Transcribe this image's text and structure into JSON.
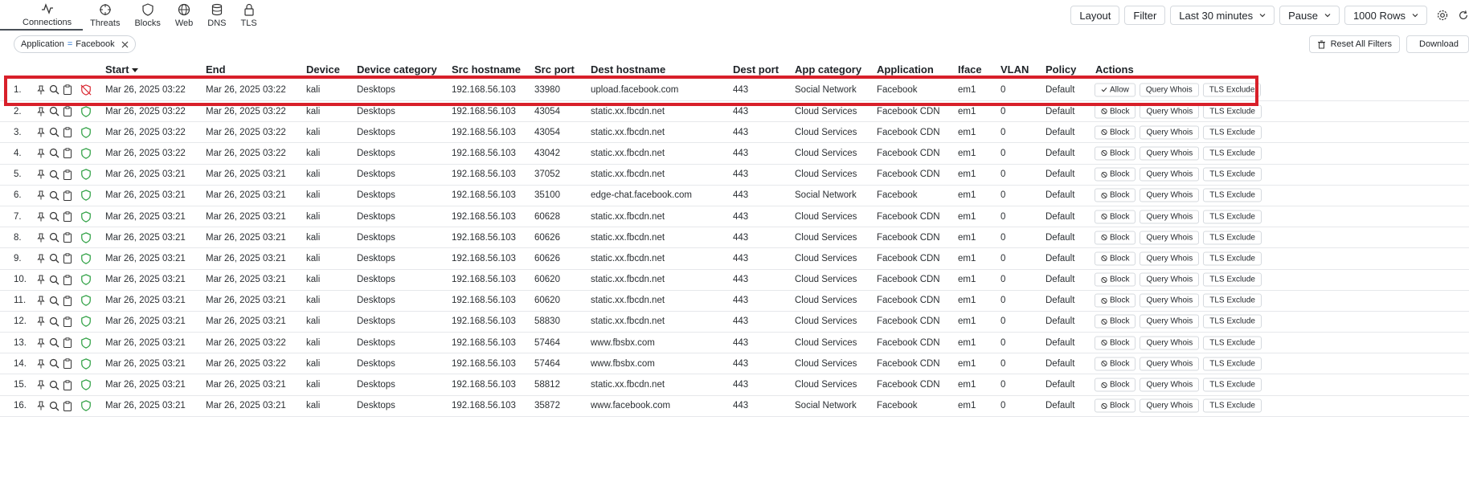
{
  "nav": {
    "tabs": [
      {
        "label": "Connections",
        "icon": "activity-icon",
        "active": true
      },
      {
        "label": "Threats",
        "icon": "crosshair-icon"
      },
      {
        "label": "Blocks",
        "icon": "shield-icon"
      },
      {
        "label": "Web",
        "icon": "globe-icon"
      },
      {
        "label": "DNS",
        "icon": "database-icon"
      },
      {
        "label": "TLS",
        "icon": "lock-icon"
      }
    ]
  },
  "toolbar": {
    "layout": "Layout",
    "filter": "Filter",
    "timerange": "Last 30 minutes",
    "pause": "Pause",
    "rows": "1000 Rows"
  },
  "filters": {
    "chip_key": "Application",
    "chip_op": "=",
    "chip_value": "Facebook",
    "reset": "Reset All Filters",
    "download": "Download"
  },
  "table": {
    "headers": {
      "start": "Start",
      "end": "End",
      "device": "Device",
      "device_category": "Device category",
      "src_hostname": "Src hostname",
      "src_port": "Src port",
      "dest_hostname": "Dest hostname",
      "dest_port": "Dest port",
      "app_category": "App category",
      "application": "Application",
      "iface": "Iface",
      "vlan": "VLAN",
      "policy": "Policy",
      "actions": "Actions"
    },
    "actions": {
      "allow": "Allow",
      "block": "Block",
      "whois": "Query Whois",
      "tls": "TLS Exclude"
    },
    "rows": [
      {
        "n": "1.",
        "start": "Mar 26, 2025 03:22",
        "end": "Mar 26, 2025 03:22",
        "device": "kali",
        "cat": "Desktops",
        "src": "192.168.56.103",
        "sport": "33980",
        "dest": "upload.facebook.com",
        "dport": "443",
        "appcat": "Social Network",
        "app": "Facebook",
        "iface": "em1",
        "vlan": "0",
        "policy": "Default",
        "blocked": true
      },
      {
        "n": "2.",
        "start": "Mar 26, 2025 03:22",
        "end": "Mar 26, 2025 03:22",
        "device": "kali",
        "cat": "Desktops",
        "src": "192.168.56.103",
        "sport": "43054",
        "dest": "static.xx.fbcdn.net",
        "dport": "443",
        "appcat": "Cloud Services",
        "app": "Facebook CDN",
        "iface": "em1",
        "vlan": "0",
        "policy": "Default",
        "blocked": false
      },
      {
        "n": "3.",
        "start": "Mar 26, 2025 03:22",
        "end": "Mar 26, 2025 03:22",
        "device": "kali",
        "cat": "Desktops",
        "src": "192.168.56.103",
        "sport": "43054",
        "dest": "static.xx.fbcdn.net",
        "dport": "443",
        "appcat": "Cloud Services",
        "app": "Facebook CDN",
        "iface": "em1",
        "vlan": "0",
        "policy": "Default",
        "blocked": false
      },
      {
        "n": "4.",
        "start": "Mar 26, 2025 03:22",
        "end": "Mar 26, 2025 03:22",
        "device": "kali",
        "cat": "Desktops",
        "src": "192.168.56.103",
        "sport": "43042",
        "dest": "static.xx.fbcdn.net",
        "dport": "443",
        "appcat": "Cloud Services",
        "app": "Facebook CDN",
        "iface": "em1",
        "vlan": "0",
        "policy": "Default",
        "blocked": false
      },
      {
        "n": "5.",
        "start": "Mar 26, 2025 03:21",
        "end": "Mar 26, 2025 03:21",
        "device": "kali",
        "cat": "Desktops",
        "src": "192.168.56.103",
        "sport": "37052",
        "dest": "static.xx.fbcdn.net",
        "dport": "443",
        "appcat": "Cloud Services",
        "app": "Facebook CDN",
        "iface": "em1",
        "vlan": "0",
        "policy": "Default",
        "blocked": false
      },
      {
        "n": "6.",
        "start": "Mar 26, 2025 03:21",
        "end": "Mar 26, 2025 03:21",
        "device": "kali",
        "cat": "Desktops",
        "src": "192.168.56.103",
        "sport": "35100",
        "dest": "edge-chat.facebook.com",
        "dport": "443",
        "appcat": "Social Network",
        "app": "Facebook",
        "iface": "em1",
        "vlan": "0",
        "policy": "Default",
        "blocked": false
      },
      {
        "n": "7.",
        "start": "Mar 26, 2025 03:21",
        "end": "Mar 26, 2025 03:21",
        "device": "kali",
        "cat": "Desktops",
        "src": "192.168.56.103",
        "sport": "60628",
        "dest": "static.xx.fbcdn.net",
        "dport": "443",
        "appcat": "Cloud Services",
        "app": "Facebook CDN",
        "iface": "em1",
        "vlan": "0",
        "policy": "Default",
        "blocked": false
      },
      {
        "n": "8.",
        "start": "Mar 26, 2025 03:21",
        "end": "Mar 26, 2025 03:21",
        "device": "kali",
        "cat": "Desktops",
        "src": "192.168.56.103",
        "sport": "60626",
        "dest": "static.xx.fbcdn.net",
        "dport": "443",
        "appcat": "Cloud Services",
        "app": "Facebook CDN",
        "iface": "em1",
        "vlan": "0",
        "policy": "Default",
        "blocked": false
      },
      {
        "n": "9.",
        "start": "Mar 26, 2025 03:21",
        "end": "Mar 26, 2025 03:21",
        "device": "kali",
        "cat": "Desktops",
        "src": "192.168.56.103",
        "sport": "60626",
        "dest": "static.xx.fbcdn.net",
        "dport": "443",
        "appcat": "Cloud Services",
        "app": "Facebook CDN",
        "iface": "em1",
        "vlan": "0",
        "policy": "Default",
        "blocked": false
      },
      {
        "n": "10.",
        "start": "Mar 26, 2025 03:21",
        "end": "Mar 26, 2025 03:21",
        "device": "kali",
        "cat": "Desktops",
        "src": "192.168.56.103",
        "sport": "60620",
        "dest": "static.xx.fbcdn.net",
        "dport": "443",
        "appcat": "Cloud Services",
        "app": "Facebook CDN",
        "iface": "em1",
        "vlan": "0",
        "policy": "Default",
        "blocked": false
      },
      {
        "n": "11.",
        "start": "Mar 26, 2025 03:21",
        "end": "Mar 26, 2025 03:21",
        "device": "kali",
        "cat": "Desktops",
        "src": "192.168.56.103",
        "sport": "60620",
        "dest": "static.xx.fbcdn.net",
        "dport": "443",
        "appcat": "Cloud Services",
        "app": "Facebook CDN",
        "iface": "em1",
        "vlan": "0",
        "policy": "Default",
        "blocked": false
      },
      {
        "n": "12.",
        "start": "Mar 26, 2025 03:21",
        "end": "Mar 26, 2025 03:21",
        "device": "kali",
        "cat": "Desktops",
        "src": "192.168.56.103",
        "sport": "58830",
        "dest": "static.xx.fbcdn.net",
        "dport": "443",
        "appcat": "Cloud Services",
        "app": "Facebook CDN",
        "iface": "em1",
        "vlan": "0",
        "policy": "Default",
        "blocked": false
      },
      {
        "n": "13.",
        "start": "Mar 26, 2025 03:21",
        "end": "Mar 26, 2025 03:22",
        "device": "kali",
        "cat": "Desktops",
        "src": "192.168.56.103",
        "sport": "57464",
        "dest": "www.fbsbx.com",
        "dport": "443",
        "appcat": "Cloud Services",
        "app": "Facebook CDN",
        "iface": "em1",
        "vlan": "0",
        "policy": "Default",
        "blocked": false
      },
      {
        "n": "14.",
        "start": "Mar 26, 2025 03:21",
        "end": "Mar 26, 2025 03:22",
        "device": "kali",
        "cat": "Desktops",
        "src": "192.168.56.103",
        "sport": "57464",
        "dest": "www.fbsbx.com",
        "dport": "443",
        "appcat": "Cloud Services",
        "app": "Facebook CDN",
        "iface": "em1",
        "vlan": "0",
        "policy": "Default",
        "blocked": false
      },
      {
        "n": "15.",
        "start": "Mar 26, 2025 03:21",
        "end": "Mar 26, 2025 03:21",
        "device": "kali",
        "cat": "Desktops",
        "src": "192.168.56.103",
        "sport": "58812",
        "dest": "static.xx.fbcdn.net",
        "dport": "443",
        "appcat": "Cloud Services",
        "app": "Facebook CDN",
        "iface": "em1",
        "vlan": "0",
        "policy": "Default",
        "blocked": false
      },
      {
        "n": "16.",
        "start": "Mar 26, 2025 03:21",
        "end": "Mar 26, 2025 03:21",
        "device": "kali",
        "cat": "Desktops",
        "src": "192.168.56.103",
        "sport": "35872",
        "dest": "www.facebook.com",
        "dport": "443",
        "appcat": "Social Network",
        "app": "Facebook",
        "iface": "em1",
        "vlan": "0",
        "policy": "Default",
        "blocked": false
      }
    ]
  },
  "colors": {
    "accent": "#1f6fd0",
    "shield_ok": "#2ea043",
    "shield_blocked": "#d8202a",
    "highlight": "#d8202a"
  }
}
